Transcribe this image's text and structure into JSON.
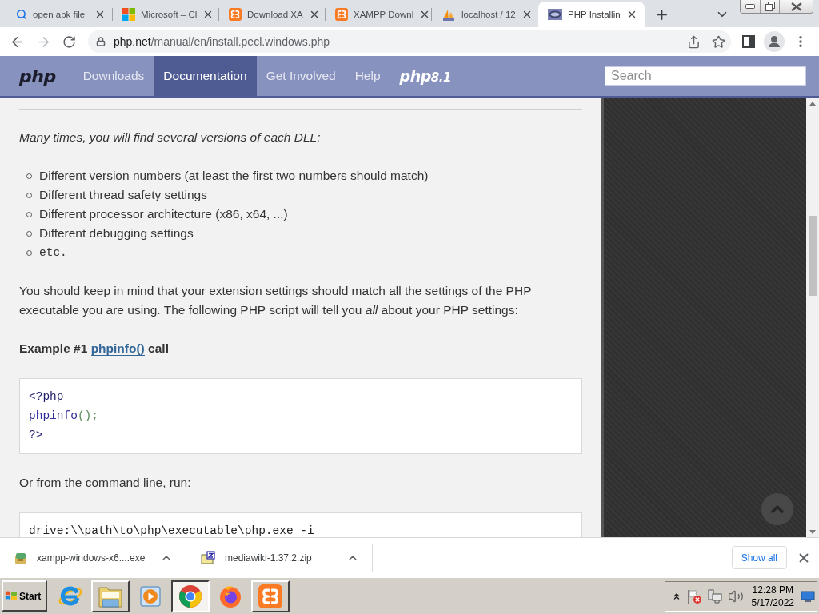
{
  "browser": {
    "tabs": [
      {
        "kind": "search",
        "title": "open apk file",
        "selected": false
      },
      {
        "kind": "microsoft",
        "title": "Microsoft – Cl",
        "selected": false
      },
      {
        "kind": "xampp",
        "title": "Download XA",
        "selected": false
      },
      {
        "kind": "xampp",
        "title": "XAMPP Downl",
        "selected": false
      },
      {
        "kind": "phpmyadmin",
        "title": "localhost / 12",
        "selected": false
      },
      {
        "kind": "php",
        "title": "PHP Installin",
        "selected": true
      }
    ],
    "nav_buttons": [
      {
        "kind": "back",
        "disabled": false
      },
      {
        "kind": "forward",
        "disabled": true
      },
      {
        "kind": "reload",
        "disabled": false
      }
    ],
    "url": {
      "host": "php.net",
      "path": "/manual/en/install.pecl.windows.php"
    }
  },
  "site_nav": {
    "logo": "php",
    "links": [
      {
        "label": "Downloads",
        "selected": false
      },
      {
        "label": "Documentation",
        "selected": true
      },
      {
        "label": "Get Involved",
        "selected": false
      },
      {
        "label": "Help",
        "selected": false
      }
    ],
    "release_logo": {
      "name": "php",
      "version": "8.1"
    },
    "search": {
      "placeholder": "Search"
    }
  },
  "content": {
    "intro": "Many times, you will find several versions of each DLL:",
    "list": [
      {
        "kind": "text",
        "text": "Different version numbers (at least the first two numbers should match)"
      },
      {
        "kind": "text",
        "text": "Different thread safety settings"
      },
      {
        "kind": "text",
        "text": "Different processor architecture (x86, x64, ...)"
      },
      {
        "kind": "text",
        "text": "Different debugging settings"
      },
      {
        "kind": "code",
        "text": "etc."
      }
    ],
    "paragraph": "You should keep in mind that your extension settings should match all the settings of the PHP executable you are using. The following PHP script will tell you *all* about your PHP settings:",
    "example": {
      "label": "Example #1",
      "link": "phpinfo()",
      "suffix": "call"
    },
    "code_block": [
      [
        {
          "kind": "tag",
          "text": "<?php"
        }
      ],
      [
        {
          "kind": "default",
          "text": "phpinfo"
        },
        {
          "kind": "keyword",
          "text": "();"
        }
      ],
      [
        {
          "kind": "tag",
          "text": "?>"
        }
      ]
    ],
    "command_intro": "Or from the command line, run:",
    "command_block": [
      [
        {
          "kind": "plain",
          "text": "drive:\\\\path\\to\\php\\executable\\php.exe -i"
        }
      ]
    ]
  },
  "downloads": {
    "items": [
      {
        "kind": "installer",
        "filename": "xampp-windows-x6....exe"
      },
      {
        "kind": "archive",
        "filename": "mediawiki-1.37.2.zip"
      }
    ],
    "show_all": "Show all"
  },
  "taskbar": {
    "start": "Start",
    "apps": [
      {
        "kind": "internet-explorer",
        "running": false,
        "selected": false
      },
      {
        "kind": "explorer",
        "running": true,
        "selected": false
      },
      {
        "kind": "media-player",
        "running": false,
        "selected": false
      },
      {
        "kind": "chrome",
        "running": true,
        "selected": true
      },
      {
        "kind": "firefox",
        "running": false,
        "selected": false
      },
      {
        "kind": "xampp",
        "running": true,
        "selected": false
      }
    ],
    "clock": {
      "time": "12:28 PM",
      "date": "5/17/2022"
    }
  }
}
